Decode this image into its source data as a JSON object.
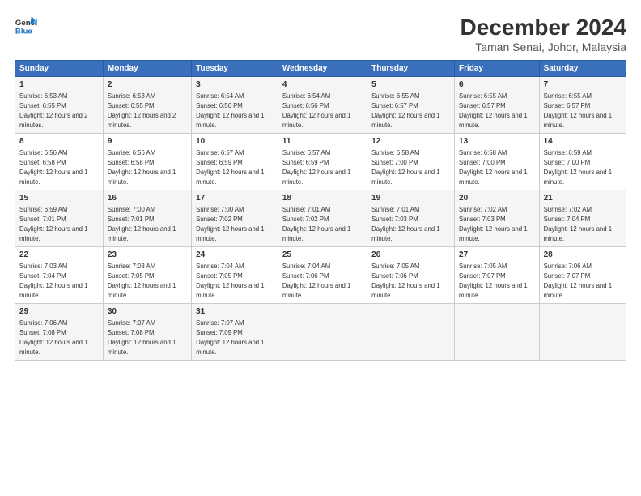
{
  "logo": {
    "line1": "General",
    "line2": "Blue"
  },
  "title": "December 2024",
  "subtitle": "Taman Senai, Johor, Malaysia",
  "days_of_week": [
    "Sunday",
    "Monday",
    "Tuesday",
    "Wednesday",
    "Thursday",
    "Friday",
    "Saturday"
  ],
  "weeks": [
    [
      {
        "day": 1,
        "rise": "6:53 AM",
        "set": "6:55 PM",
        "daylight": "12 hours and 2 minutes"
      },
      {
        "day": 2,
        "rise": "6:53 AM",
        "set": "6:55 PM",
        "daylight": "12 hours and 2 minutes"
      },
      {
        "day": 3,
        "rise": "6:54 AM",
        "set": "6:56 PM",
        "daylight": "12 hours and 1 minute"
      },
      {
        "day": 4,
        "rise": "6:54 AM",
        "set": "6:56 PM",
        "daylight": "12 hours and 1 minute"
      },
      {
        "day": 5,
        "rise": "6:55 AM",
        "set": "6:57 PM",
        "daylight": "12 hours and 1 minute"
      },
      {
        "day": 6,
        "rise": "6:55 AM",
        "set": "6:57 PM",
        "daylight": "12 hours and 1 minute"
      },
      {
        "day": 7,
        "rise": "6:55 AM",
        "set": "6:57 PM",
        "daylight": "12 hours and 1 minute"
      }
    ],
    [
      {
        "day": 8,
        "rise": "6:56 AM",
        "set": "6:58 PM",
        "daylight": "12 hours and 1 minute"
      },
      {
        "day": 9,
        "rise": "6:56 AM",
        "set": "6:58 PM",
        "daylight": "12 hours and 1 minute"
      },
      {
        "day": 10,
        "rise": "6:57 AM",
        "set": "6:59 PM",
        "daylight": "12 hours and 1 minute"
      },
      {
        "day": 11,
        "rise": "6:57 AM",
        "set": "6:59 PM",
        "daylight": "12 hours and 1 minute"
      },
      {
        "day": 12,
        "rise": "6:58 AM",
        "set": "7:00 PM",
        "daylight": "12 hours and 1 minute"
      },
      {
        "day": 13,
        "rise": "6:58 AM",
        "set": "7:00 PM",
        "daylight": "12 hours and 1 minute"
      },
      {
        "day": 14,
        "rise": "6:59 AM",
        "set": "7:00 PM",
        "daylight": "12 hours and 1 minute"
      }
    ],
    [
      {
        "day": 15,
        "rise": "6:59 AM",
        "set": "7:01 PM",
        "daylight": "12 hours and 1 minute"
      },
      {
        "day": 16,
        "rise": "7:00 AM",
        "set": "7:01 PM",
        "daylight": "12 hours and 1 minute"
      },
      {
        "day": 17,
        "rise": "7:00 AM",
        "set": "7:02 PM",
        "daylight": "12 hours and 1 minute"
      },
      {
        "day": 18,
        "rise": "7:01 AM",
        "set": "7:02 PM",
        "daylight": "12 hours and 1 minute"
      },
      {
        "day": 19,
        "rise": "7:01 AM",
        "set": "7:03 PM",
        "daylight": "12 hours and 1 minute"
      },
      {
        "day": 20,
        "rise": "7:02 AM",
        "set": "7:03 PM",
        "daylight": "12 hours and 1 minute"
      },
      {
        "day": 21,
        "rise": "7:02 AM",
        "set": "7:04 PM",
        "daylight": "12 hours and 1 minute"
      }
    ],
    [
      {
        "day": 22,
        "rise": "7:03 AM",
        "set": "7:04 PM",
        "daylight": "12 hours and 1 minute"
      },
      {
        "day": 23,
        "rise": "7:03 AM",
        "set": "7:05 PM",
        "daylight": "12 hours and 1 minute"
      },
      {
        "day": 24,
        "rise": "7:04 AM",
        "set": "7:05 PM",
        "daylight": "12 hours and 1 minute"
      },
      {
        "day": 25,
        "rise": "7:04 AM",
        "set": "7:06 PM",
        "daylight": "12 hours and 1 minute"
      },
      {
        "day": 26,
        "rise": "7:05 AM",
        "set": "7:06 PM",
        "daylight": "12 hours and 1 minute"
      },
      {
        "day": 27,
        "rise": "7:05 AM",
        "set": "7:07 PM",
        "daylight": "12 hours and 1 minute"
      },
      {
        "day": 28,
        "rise": "7:06 AM",
        "set": "7:07 PM",
        "daylight": "12 hours and 1 minute"
      }
    ],
    [
      {
        "day": 29,
        "rise": "7:06 AM",
        "set": "7:08 PM",
        "daylight": "12 hours and 1 minute"
      },
      {
        "day": 30,
        "rise": "7:07 AM",
        "set": "7:08 PM",
        "daylight": "12 hours and 1 minute"
      },
      {
        "day": 31,
        "rise": "7:07 AM",
        "set": "7:09 PM",
        "daylight": "12 hours and 1 minute"
      },
      null,
      null,
      null,
      null
    ]
  ]
}
